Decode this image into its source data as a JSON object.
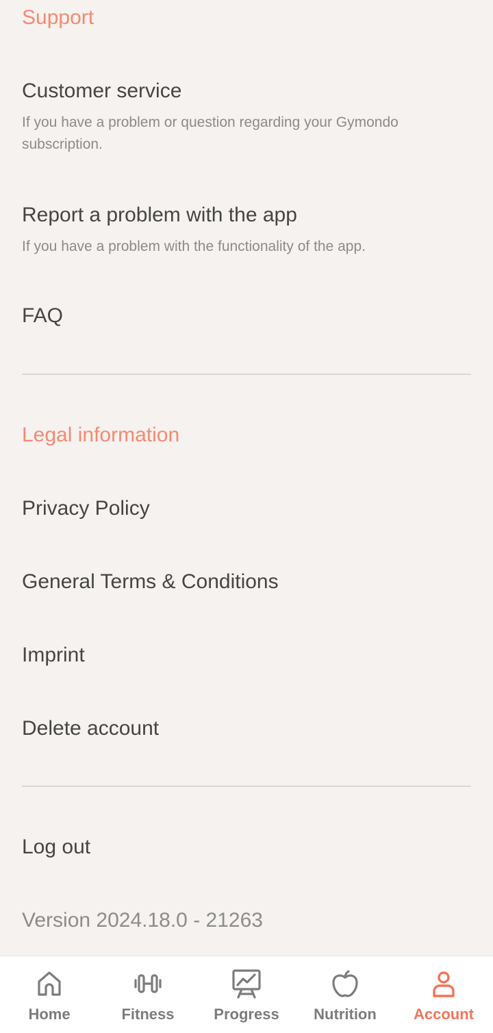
{
  "support": {
    "title": "Support",
    "customer_service_title": "Customer service",
    "customer_service_desc": "If you have a problem or question regarding your Gymondo subscription.",
    "report_title": "Report a problem with the app",
    "report_desc": "If you have a problem with the functionality of the app.",
    "faq": "FAQ"
  },
  "legal": {
    "title": "Legal information",
    "privacy": "Privacy Policy",
    "terms": "General Terms & Conditions",
    "imprint": "Imprint",
    "delete": "Delete account"
  },
  "logout": "Log out",
  "version": "Version 2024.18.0 - 21263",
  "tabs": [
    {
      "label": "Home",
      "icon": "home-icon"
    },
    {
      "label": "Fitness",
      "icon": "dumbbell-icon"
    },
    {
      "label": "Progress",
      "icon": "chart-board-icon"
    },
    {
      "label": "Nutrition",
      "icon": "apple-icon"
    },
    {
      "label": "Account",
      "icon": "person-icon"
    }
  ],
  "colors": {
    "accent": "#f47458",
    "section_title": "#f48a73",
    "text": "#454545",
    "muted": "#8b8b8b",
    "background": "#f5f2ef"
  }
}
